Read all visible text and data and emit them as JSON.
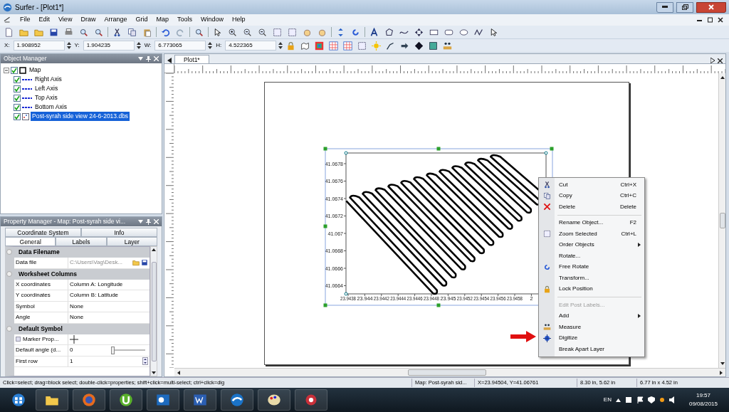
{
  "window": {
    "title": "Surfer - [Plot1*]"
  },
  "menu": [
    "File",
    "Edit",
    "View",
    "Draw",
    "Arrange",
    "Grid",
    "Map",
    "Tools",
    "Window",
    "Help"
  ],
  "position_fields": [
    {
      "label": "X:",
      "value": "1.908952"
    },
    {
      "label": "Y:",
      "value": "1.904235"
    },
    {
      "label": "W:",
      "value": "6.773065"
    },
    {
      "label": "H:",
      "value": "4.522365"
    }
  ],
  "object_manager": {
    "title": "Object Manager",
    "tree": [
      {
        "label": "Map",
        "kind": "map",
        "checked": true,
        "selected": false,
        "expanded": true,
        "children": [
          {
            "label": "Right Axis",
            "kind": "axis",
            "checked": true,
            "selected": false
          },
          {
            "label": "Left Axis",
            "kind": "axis",
            "checked": true,
            "selected": false
          },
          {
            "label": "Top Axis",
            "kind": "axis",
            "checked": true,
            "selected": false
          },
          {
            "label": "Bottom Axis",
            "kind": "axis",
            "checked": true,
            "selected": false
          },
          {
            "label": "Post-syrah side view 24-6-2013.dbs",
            "kind": "post",
            "checked": true,
            "selected": true
          }
        ]
      }
    ]
  },
  "property_manager": {
    "title": "Property Manager - Map: Post-syrah side vi...",
    "tabs": [
      {
        "label": "Coordinate System",
        "selected": false
      },
      {
        "label": "Info",
        "selected": false
      },
      {
        "label": "General",
        "selected": true
      },
      {
        "label": "Labels",
        "selected": false
      },
      {
        "label": "Layer",
        "selected": false
      }
    ],
    "sections": [
      {
        "title": "Data Filename",
        "rows": [
          {
            "name": "Data file",
            "kind": "file",
            "value": "C:\\Users\\Vag\\Desk..."
          }
        ]
      },
      {
        "title": "Worksheet Columns",
        "rows": [
          {
            "name": "X coordinates",
            "kind": "text",
            "value": "Column A:  Longitude"
          },
          {
            "name": "Y coordinates",
            "kind": "text",
            "value": "Column B:  Latitude"
          },
          {
            "name": "Symbol",
            "kind": "text",
            "value": "None"
          },
          {
            "name": "Angle",
            "kind": "text",
            "value": "None"
          }
        ]
      },
      {
        "title": "Default Symbol",
        "rows": [
          {
            "name": "Marker Prop...",
            "kind": "marker"
          },
          {
            "name": "Default angle (d...",
            "kind": "slider",
            "value": "0",
            "level": 0.0
          },
          {
            "name": "First row",
            "kind": "spinner",
            "value": "1"
          }
        ]
      }
    ]
  },
  "document_tabs": [
    {
      "label": "Plot1*",
      "selected": true
    }
  ],
  "plot": {
    "y_labels": [
      "41.0678",
      "41.0676",
      "41.0674",
      "41.0672",
      "41.067",
      "41.0668",
      "41.0666",
      "41.0664"
    ],
    "x_labels": [
      "23.9438",
      "23.944",
      "23.9442",
      "23.9444",
      "23.9446",
      "23.9448",
      "23.945",
      "23.9452",
      "23.9454",
      "23.9456",
      "23.9458",
      "2"
    ]
  },
  "context_menu": [
    {
      "kind": "item",
      "label": "Cut",
      "shortcut": "Ctrl+X",
      "disabled": false
    },
    {
      "kind": "item",
      "label": "Copy",
      "shortcut": "Ctrl+C",
      "disabled": false
    },
    {
      "kind": "item",
      "label": "Delete",
      "shortcut": "Delete",
      "disabled": false
    },
    {
      "kind": "separator"
    },
    {
      "kind": "item",
      "label": "Rename Object...",
      "shortcut": "F2",
      "disabled": false
    },
    {
      "kind": "item",
      "label": "Zoom Selected",
      "shortcut": "Ctrl+L",
      "disabled": false
    },
    {
      "kind": "submenu",
      "label": "Order Objects",
      "disabled": false
    },
    {
      "kind": "item",
      "label": "Rotate...",
      "disabled": false
    },
    {
      "kind": "item",
      "label": "Free Rotate",
      "disabled": false
    },
    {
      "kind": "item",
      "label": "Transform...",
      "disabled": false
    },
    {
      "kind": "item",
      "label": "Lock Position",
      "disabled": false
    },
    {
      "kind": "separator"
    },
    {
      "kind": "item",
      "label": "Edit Post Labels...",
      "disabled": true
    },
    {
      "kind": "submenu",
      "label": "Add",
      "disabled": false
    },
    {
      "kind": "item",
      "label": "Measure",
      "disabled": false
    },
    {
      "kind": "item",
      "label": "Digitize",
      "disabled": false
    },
    {
      "kind": "item",
      "label": "Break Apart Layer",
      "disabled": false
    }
  ],
  "status_bar": {
    "hint": "Click=select; drag=block select; double-click=properties; shift+click=multi-select; ctrl+click=dig",
    "panes": [
      "Map: Post-syrah sid...",
      "X=23.94504, Y=41.06761",
      "8.30 in, 5.62 in",
      "6.77 in x 4.52 in"
    ]
  },
  "taskbar": {
    "language": "EN",
    "time": "19:57",
    "date": "09/08/2015"
  }
}
